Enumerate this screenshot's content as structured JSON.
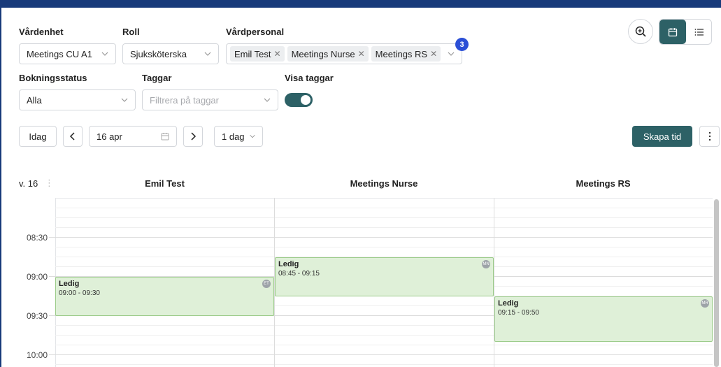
{
  "filters": {
    "vardenhet": {
      "label": "Vårdenhet",
      "value": "Meetings CU A1"
    },
    "roll": {
      "label": "Roll",
      "value": "Sjuksköterska"
    },
    "vardpersonal": {
      "label": "Vårdpersonal",
      "tags": [
        "Emil Test",
        "Meetings Nurse",
        "Meetings RS"
      ],
      "count": "3"
    },
    "bokningsstatus": {
      "label": "Bokningsstatus",
      "value": "Alla"
    },
    "taggar": {
      "label": "Taggar",
      "placeholder": "Filtrera på taggar"
    },
    "visa_taggar": {
      "label": "Visa taggar",
      "on": true
    }
  },
  "toolbar": {
    "today": "Idag",
    "date": "16 apr",
    "view": "1 dag",
    "create": "Skapa tid"
  },
  "calendar": {
    "week": "v. 16",
    "columns": [
      "Emil Test",
      "Meetings Nurse",
      "Meetings RS"
    ],
    "times": [
      "08:30",
      "09:00",
      "09:30",
      "10:00"
    ],
    "events": [
      {
        "title": "Ledig",
        "range": "09:00 - 09:30",
        "initials": "ET"
      },
      {
        "title": "Ledig",
        "range": "08:45 - 09:15",
        "initials": "MN"
      },
      {
        "title": "Ledig",
        "range": "09:15 - 09:50",
        "initials": "MR"
      }
    ]
  },
  "colors": {
    "primary": "#2d6166",
    "badge": "#2b4fd6",
    "event_bg": "#dff0d8",
    "event_border": "#9ccc8a",
    "frame": "#183a7a"
  }
}
